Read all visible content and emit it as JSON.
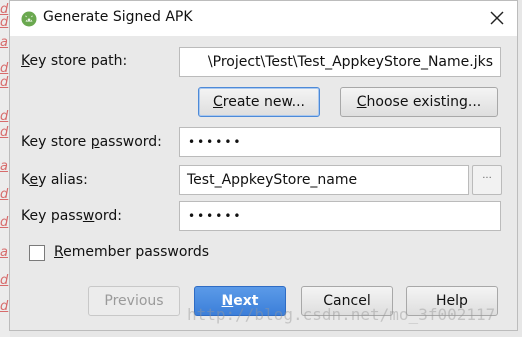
{
  "background": {
    "side_marks": [
      "d",
      "d",
      "a",
      "d",
      "d",
      "d",
      "d",
      "a",
      "d",
      "d",
      "a",
      "d",
      "d"
    ]
  },
  "dialog": {
    "title": "Generate Signed APK",
    "icon": "android-studio-icon",
    "close_icon": "close-icon"
  },
  "form": {
    "key_store_path": {
      "label_pre": "",
      "label_mnemonic": "K",
      "label_post": "ey store path:",
      "value": "\\Project\\Test\\Test_AppkeyStore_Name.jks"
    },
    "create_new_label": {
      "pre": "",
      "mnemonic": "C",
      "post": "reate new..."
    },
    "choose_existing_label": {
      "pre": "",
      "mnemonic": "C",
      "post": "hoose existing..."
    },
    "key_store_password": {
      "label_pre": "Key store ",
      "label_mnemonic": "p",
      "label_post": "assword:",
      "value": "••••••"
    },
    "key_alias": {
      "label_pre": "K",
      "label_mnemonic": "e",
      "label_post": "y alias:",
      "value": "Test_AppkeyStore_name",
      "browse_label": "···"
    },
    "key_password": {
      "label_pre": "Key pass",
      "label_mnemonic": "w",
      "label_post": "ord:",
      "value": "••••••"
    },
    "remember": {
      "label_pre": "",
      "label_mnemonic": "R",
      "label_post": "emember passwords",
      "checked": false
    }
  },
  "buttons": {
    "previous": "Previous",
    "next_pre": "",
    "next_mnemonic": "N",
    "next_post": "ext",
    "cancel": "Cancel",
    "help": "Help"
  },
  "watermark": "http://blog.csdn.net/mo_3f002117",
  "colors": {
    "primary_button": "#3c7fd9",
    "focus_border": "#4d8ad8",
    "android_green": "#a4c639"
  }
}
